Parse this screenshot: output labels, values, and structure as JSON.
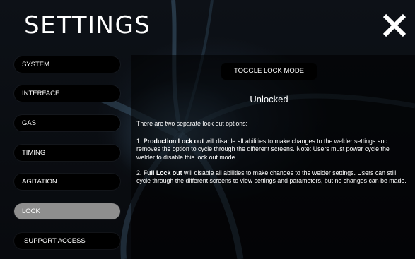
{
  "header": {
    "title": "SETTINGS",
    "close_icon": "close-icon"
  },
  "sidebar": {
    "items": [
      {
        "label": "SYSTEM",
        "active": false
      },
      {
        "label": "INTERFACE",
        "active": false
      },
      {
        "label": "GAS",
        "active": false
      },
      {
        "label": "TIMING",
        "active": false
      },
      {
        "label": "AGITATION",
        "active": false
      },
      {
        "label": "LOCK",
        "active": true
      },
      {
        "label": "SUPPORT ACCESS",
        "active": false
      }
    ]
  },
  "main": {
    "toggle_label": "TOGGLE LOCK MODE",
    "status": "Unlocked",
    "intro": "There are two separate lock out options:",
    "option1": {
      "prefix": "1. ",
      "name": "Production Lock out",
      "text": " will disable all abilities to make changes to the welder settings and removes the option to cycle through the different screens. Note: Users must power cycle the welder to disable this lock out mode."
    },
    "option2": {
      "prefix": "2. ",
      "name": "Full Lock out",
      "text": " will disable all abilities to make changes to the welder settings. Users can still cycle through the different screens to view settings and parameters, but no changes can be made."
    }
  },
  "colors": {
    "active_item": "#8e8e8e",
    "button_bg": "#000000",
    "text": "#ffffff"
  }
}
